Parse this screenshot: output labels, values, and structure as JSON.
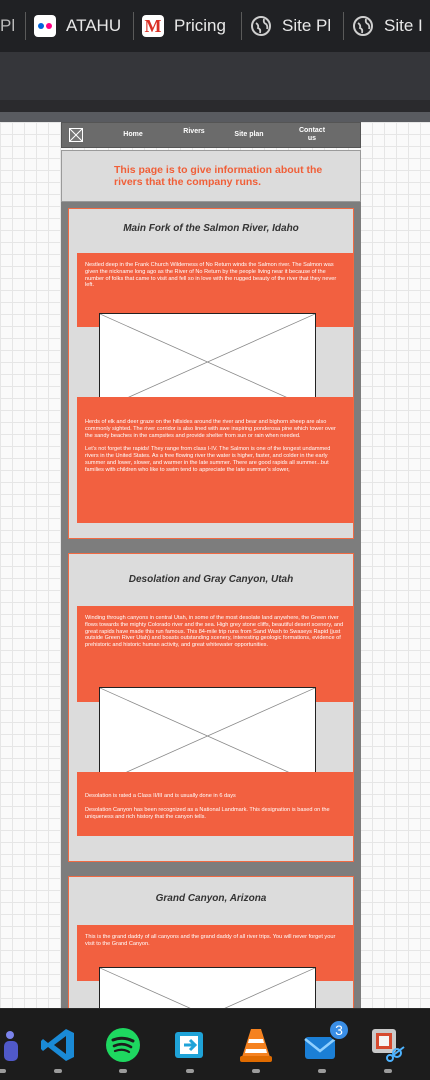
{
  "browser": {
    "tabs": [
      {
        "label": "Pl",
        "icon": "partial-tab-icon"
      },
      {
        "label": "ATAHU",
        "icon": "flickr-icon"
      },
      {
        "label": "Pricing",
        "icon": "gmail-icon"
      },
      {
        "label": "Site Pl",
        "icon": "globe-icon"
      },
      {
        "label": "Site I",
        "icon": "globe-icon"
      }
    ]
  },
  "site": {
    "nav": {
      "home": "Home",
      "rivers": "Rivers",
      "site_plan": "Site plan",
      "contact": "Contact us"
    },
    "header_text": "This page is to give information about the rivers that the company runs.",
    "rivers": [
      {
        "title": "Main Fork of the Salmon River, Idaho",
        "intro": "Nestled deep in the Frank Church Wilderness of No Return winds the Salmon river. The Salmon was given the nickname long ago as the River of No Return by the people living near it because of the number of folks that came to visit and fell so in love with the rugged beauty of the river that they never left.",
        "details": [
          "Herds of elk and deer graze on the hillsides around the river and bear and bighorn sheep are also commonly sighted. The river corridor is also lined with awe inspiring ponderosa pine which tower over the sandy beaches in the campsites and provide shelter from sun or rain when needed.",
          "Let's not forget the rapids! They range from class I-IV. The Salmon is one of the longest undammed rivers in the United States. As a free flowing river the water is higher, faster, and colder in the early summer and lower, slower, and warmer in the late summer. There are good rapids all summer...but families with children who like to swim tend to appreciate the late summer's slower,"
        ]
      },
      {
        "title": "Desolation and Gray Canyon, Utah",
        "intro": "Winding through canyons in central Utah, in some of the most desolate land anywhere, the Green river flows towards the mighty Colorado river and the sea. High grey stone cliffs, beautiful desert scenery, and great rapids have made this run famous. This 84-mile trip runs from Sand Wash to Swaseys Rapid (just outside Green River Utah) and boasts outstanding scenery, interesting geologic formations, evidence of prehistoric and historic human activity, and great whitewater opportunities.",
        "details": [
          "Desolation is rated a Class II/III and is usually done in 6 days",
          "Desolation Canyon has been recognized as a National Landmark. This designation is based on the uniqueness and rich history that the canyon tells."
        ]
      },
      {
        "title": "Grand Canyon, Arizona",
        "intro": "This is the grand daddy of all canyons and the grand daddy of all river trips. You will never forget your visit to the Grand Canyon.",
        "details": []
      }
    ]
  },
  "taskbar": {
    "apps": [
      "teams-icon",
      "vscode-icon",
      "spotify-icon",
      "ssh-client-icon",
      "vlc-icon",
      "mail-icon",
      "snipping-tool-icon"
    ],
    "mail_badge": "3"
  }
}
